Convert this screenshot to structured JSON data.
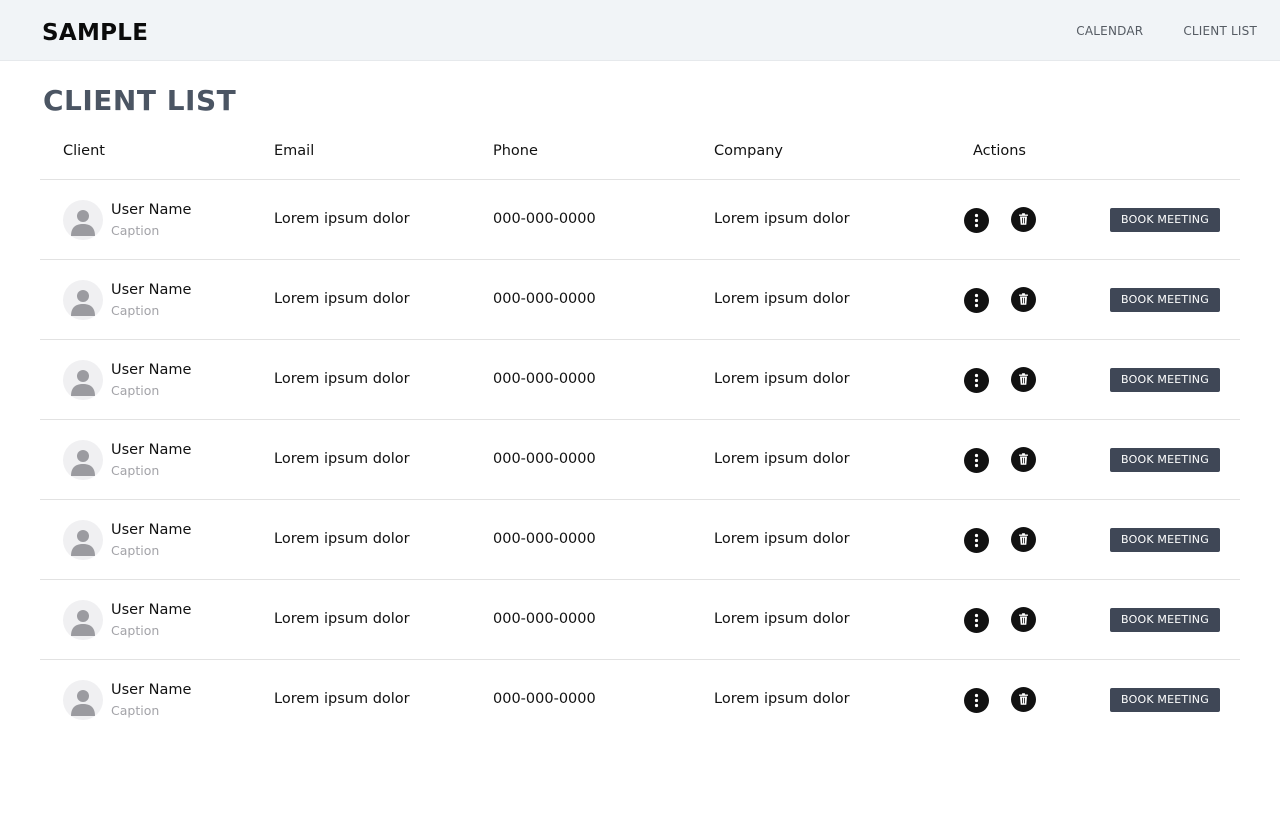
{
  "header": {
    "brand": "SAMPLE",
    "nav": [
      "CALENDAR",
      "CLIENT LIST"
    ]
  },
  "page": {
    "title": "CLIENT LIST"
  },
  "table": {
    "columns": [
      "Client",
      "Email",
      "Phone",
      "Company",
      "Actions"
    ],
    "rows": [
      {
        "name": "User Name",
        "caption": "Caption",
        "email": "Lorem ipsum dolor",
        "phone": "000-000-0000",
        "company": "Lorem ipsum dolor",
        "action": "BOOK MEETING"
      },
      {
        "name": "User Name",
        "caption": "Caption",
        "email": "Lorem ipsum dolor",
        "phone": "000-000-0000",
        "company": "Lorem ipsum dolor",
        "action": "BOOK MEETING"
      },
      {
        "name": "User Name",
        "caption": "Caption",
        "email": "Lorem ipsum dolor",
        "phone": "000-000-0000",
        "company": "Lorem ipsum dolor",
        "action": "BOOK MEETING"
      },
      {
        "name": "User Name",
        "caption": "Caption",
        "email": "Lorem ipsum dolor",
        "phone": "000-000-0000",
        "company": "Lorem ipsum dolor",
        "action": "BOOK MEETING"
      },
      {
        "name": "User Name",
        "caption": "Caption",
        "email": "Lorem ipsum dolor",
        "phone": "000-000-0000",
        "company": "Lorem ipsum dolor",
        "action": "BOOK MEETING"
      },
      {
        "name": "User Name",
        "caption": "Caption",
        "email": "Lorem ipsum dolor",
        "phone": "000-000-0000",
        "company": "Lorem ipsum dolor",
        "action": "BOOK MEETING"
      },
      {
        "name": "User Name",
        "caption": "Caption",
        "email": "Lorem ipsum dolor",
        "phone": "000-000-0000",
        "company": "Lorem ipsum dolor",
        "action": "BOOK MEETING"
      }
    ]
  },
  "icons": {
    "avatar": "user-avatar-icon",
    "more": "more-vertical-icon",
    "delete": "trash-icon"
  },
  "colors": {
    "header_bg": "#f1f4f7",
    "title": "#4b5563",
    "button_bg": "#3f4756",
    "icon_bg": "#111111"
  }
}
